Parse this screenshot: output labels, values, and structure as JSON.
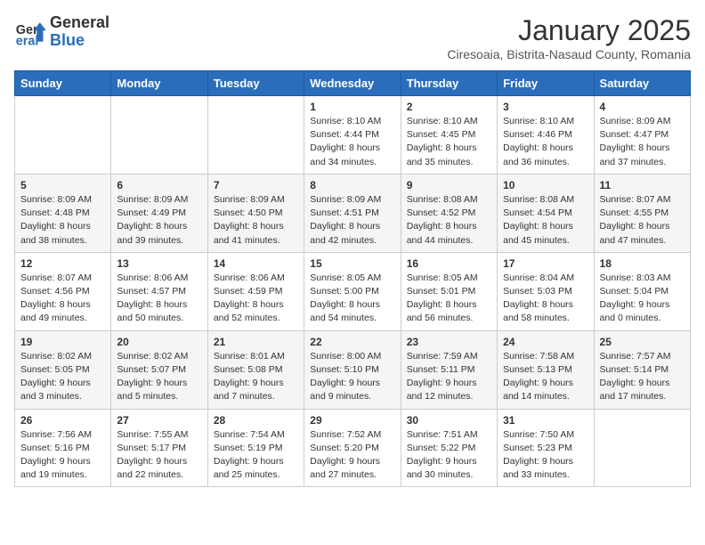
{
  "logo": {
    "general": "General",
    "blue": "Blue"
  },
  "header": {
    "month": "January 2025",
    "location": "Ciresoaia, Bistrita-Nasaud County, Romania"
  },
  "weekdays": [
    "Sunday",
    "Monday",
    "Tuesday",
    "Wednesday",
    "Thursday",
    "Friday",
    "Saturday"
  ],
  "weeks": [
    [
      {
        "day": "",
        "info": ""
      },
      {
        "day": "",
        "info": ""
      },
      {
        "day": "",
        "info": ""
      },
      {
        "day": "1",
        "info": "Sunrise: 8:10 AM\nSunset: 4:44 PM\nDaylight: 8 hours and 34 minutes."
      },
      {
        "day": "2",
        "info": "Sunrise: 8:10 AM\nSunset: 4:45 PM\nDaylight: 8 hours and 35 minutes."
      },
      {
        "day": "3",
        "info": "Sunrise: 8:10 AM\nSunset: 4:46 PM\nDaylight: 8 hours and 36 minutes."
      },
      {
        "day": "4",
        "info": "Sunrise: 8:09 AM\nSunset: 4:47 PM\nDaylight: 8 hours and 37 minutes."
      }
    ],
    [
      {
        "day": "5",
        "info": "Sunrise: 8:09 AM\nSunset: 4:48 PM\nDaylight: 8 hours and 38 minutes."
      },
      {
        "day": "6",
        "info": "Sunrise: 8:09 AM\nSunset: 4:49 PM\nDaylight: 8 hours and 39 minutes."
      },
      {
        "day": "7",
        "info": "Sunrise: 8:09 AM\nSunset: 4:50 PM\nDaylight: 8 hours and 41 minutes."
      },
      {
        "day": "8",
        "info": "Sunrise: 8:09 AM\nSunset: 4:51 PM\nDaylight: 8 hours and 42 minutes."
      },
      {
        "day": "9",
        "info": "Sunrise: 8:08 AM\nSunset: 4:52 PM\nDaylight: 8 hours and 44 minutes."
      },
      {
        "day": "10",
        "info": "Sunrise: 8:08 AM\nSunset: 4:54 PM\nDaylight: 8 hours and 45 minutes."
      },
      {
        "day": "11",
        "info": "Sunrise: 8:07 AM\nSunset: 4:55 PM\nDaylight: 8 hours and 47 minutes."
      }
    ],
    [
      {
        "day": "12",
        "info": "Sunrise: 8:07 AM\nSunset: 4:56 PM\nDaylight: 8 hours and 49 minutes."
      },
      {
        "day": "13",
        "info": "Sunrise: 8:06 AM\nSunset: 4:57 PM\nDaylight: 8 hours and 50 minutes."
      },
      {
        "day": "14",
        "info": "Sunrise: 8:06 AM\nSunset: 4:59 PM\nDaylight: 8 hours and 52 minutes."
      },
      {
        "day": "15",
        "info": "Sunrise: 8:05 AM\nSunset: 5:00 PM\nDaylight: 8 hours and 54 minutes."
      },
      {
        "day": "16",
        "info": "Sunrise: 8:05 AM\nSunset: 5:01 PM\nDaylight: 8 hours and 56 minutes."
      },
      {
        "day": "17",
        "info": "Sunrise: 8:04 AM\nSunset: 5:03 PM\nDaylight: 8 hours and 58 minutes."
      },
      {
        "day": "18",
        "info": "Sunrise: 8:03 AM\nSunset: 5:04 PM\nDaylight: 9 hours and 0 minutes."
      }
    ],
    [
      {
        "day": "19",
        "info": "Sunrise: 8:02 AM\nSunset: 5:05 PM\nDaylight: 9 hours and 3 minutes."
      },
      {
        "day": "20",
        "info": "Sunrise: 8:02 AM\nSunset: 5:07 PM\nDaylight: 9 hours and 5 minutes."
      },
      {
        "day": "21",
        "info": "Sunrise: 8:01 AM\nSunset: 5:08 PM\nDaylight: 9 hours and 7 minutes."
      },
      {
        "day": "22",
        "info": "Sunrise: 8:00 AM\nSunset: 5:10 PM\nDaylight: 9 hours and 9 minutes."
      },
      {
        "day": "23",
        "info": "Sunrise: 7:59 AM\nSunset: 5:11 PM\nDaylight: 9 hours and 12 minutes."
      },
      {
        "day": "24",
        "info": "Sunrise: 7:58 AM\nSunset: 5:13 PM\nDaylight: 9 hours and 14 minutes."
      },
      {
        "day": "25",
        "info": "Sunrise: 7:57 AM\nSunset: 5:14 PM\nDaylight: 9 hours and 17 minutes."
      }
    ],
    [
      {
        "day": "26",
        "info": "Sunrise: 7:56 AM\nSunset: 5:16 PM\nDaylight: 9 hours and 19 minutes."
      },
      {
        "day": "27",
        "info": "Sunrise: 7:55 AM\nSunset: 5:17 PM\nDaylight: 9 hours and 22 minutes."
      },
      {
        "day": "28",
        "info": "Sunrise: 7:54 AM\nSunset: 5:19 PM\nDaylight: 9 hours and 25 minutes."
      },
      {
        "day": "29",
        "info": "Sunrise: 7:52 AM\nSunset: 5:20 PM\nDaylight: 9 hours and 27 minutes."
      },
      {
        "day": "30",
        "info": "Sunrise: 7:51 AM\nSunset: 5:22 PM\nDaylight: 9 hours and 30 minutes."
      },
      {
        "day": "31",
        "info": "Sunrise: 7:50 AM\nSunset: 5:23 PM\nDaylight: 9 hours and 33 minutes."
      },
      {
        "day": "",
        "info": ""
      }
    ]
  ]
}
